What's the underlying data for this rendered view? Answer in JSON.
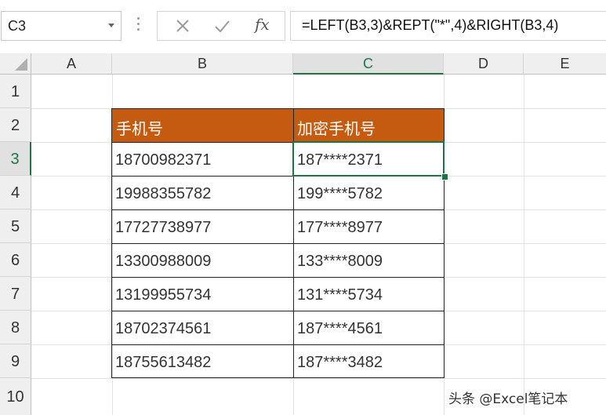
{
  "name_box": {
    "value": "C3"
  },
  "formula_bar": {
    "cancel_icon": "cross-icon",
    "enter_icon": "check-icon",
    "function_label": "fx",
    "formula": "=LEFT(B3,3)&REPT(\"*\",4)&RIGHT(B3,4)"
  },
  "columns": [
    "A",
    "B",
    "C",
    "D",
    "E"
  ],
  "rows": [
    "1",
    "2",
    "3",
    "4",
    "5",
    "6",
    "7",
    "8",
    "9",
    "10"
  ],
  "selected_cell": "C3",
  "accent_color": "#217346",
  "header_fill_color": "#c55a11",
  "table": {
    "headers": [
      "手机号",
      "加密手机号"
    ],
    "rows": [
      [
        "18700982371",
        "187****2371"
      ],
      [
        "19988355782",
        "199****5782"
      ],
      [
        "17727738977",
        "177****8977"
      ],
      [
        "13300988009",
        "133****8009"
      ],
      [
        "13199955734",
        "131****5734"
      ],
      [
        "18702374561",
        "187****4561"
      ],
      [
        "18755613482",
        "187****3482"
      ]
    ]
  },
  "watermark": "头条 @Excel笔记本"
}
